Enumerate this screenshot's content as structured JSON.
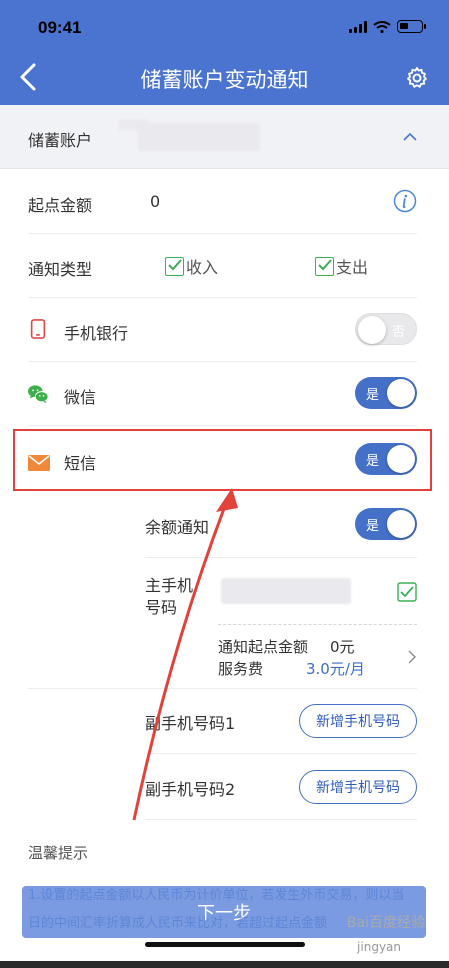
{
  "status_bar": {
    "time": "09:41"
  },
  "nav": {
    "title": "储蓄账户变动通知"
  },
  "account": {
    "label": "储蓄账户"
  },
  "start_amount": {
    "label": "起点金额",
    "value": "0"
  },
  "notify_type": {
    "label": "通知类型",
    "income": "收入",
    "expense": "支出"
  },
  "mobile_bank": {
    "label": "手机银行",
    "toggle": "否",
    "on": false
  },
  "wechat": {
    "label": "微信",
    "toggle": "是",
    "on": true
  },
  "sms": {
    "label": "短信",
    "toggle": "是",
    "on": true
  },
  "balance_notice": {
    "label": "余额通知",
    "toggle": "是",
    "on": true
  },
  "main_phone": {
    "label_line1": "主手机",
    "label_line2": "号码"
  },
  "sub_info": {
    "start_amount_label": "通知起点金额",
    "start_amount_value": "0元",
    "fee_label": "服务费",
    "fee_value": "3.0元/月"
  },
  "sub_phone_1": {
    "label": "副手机号码1",
    "button": "新增手机号码"
  },
  "sub_phone_2": {
    "label": "副手机号码2",
    "button": "新增手机号码"
  },
  "tips": {
    "title": "温馨提示",
    "text": "1.设置的起点金额以人民币为计价单位，若发生外币交易，则以当日的中间汇率折算成人民币来比对，若超过起点金额"
  },
  "next_button": "下一步",
  "watermark": {
    "brand": "Bai百度经验",
    "sub": "jingyan"
  },
  "colors": {
    "nav": "#4a74cf",
    "toggle_on": "#4470c8",
    "check": "#3cae55",
    "highlight": "#e2423c",
    "arrow": "#e2423c"
  }
}
